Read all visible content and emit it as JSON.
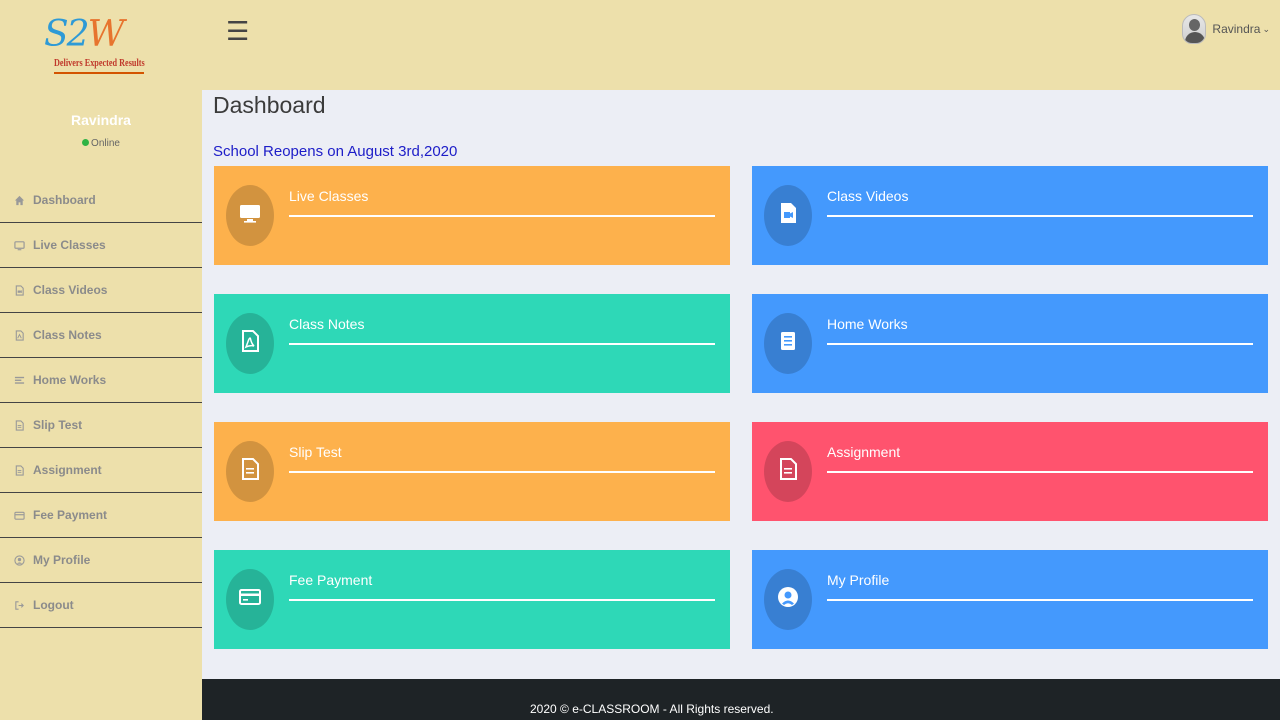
{
  "header": {
    "logo_main_1": "S2",
    "logo_main_2": "W",
    "logo_tagline": "Delivers Expected Results",
    "menu_icon": "hamburger-icon",
    "user_name": "Ravindra",
    "caret_glyph": "⌄"
  },
  "sidebar": {
    "user_name": "Ravindra",
    "status": "Online",
    "items": [
      {
        "label": "Dashboard",
        "icon": "home-icon"
      },
      {
        "label": "Live Classes",
        "icon": "monitor-icon"
      },
      {
        "label": "Class Videos",
        "icon": "video-file-icon"
      },
      {
        "label": "Class Notes",
        "icon": "pdf-file-icon"
      },
      {
        "label": "Home Works",
        "icon": "list-icon"
      },
      {
        "label": "Slip Test",
        "icon": "document-icon"
      },
      {
        "label": "Assignment",
        "icon": "document-icon"
      },
      {
        "label": "Fee Payment",
        "icon": "credit-card-icon"
      },
      {
        "label": "My Profile",
        "icon": "user-circle-icon"
      },
      {
        "label": "Logout",
        "icon": "logout-icon"
      }
    ]
  },
  "main": {
    "title": "Dashboard",
    "notice": "School Reopens on August 3rd,2020",
    "cards": [
      {
        "label": "Live Classes",
        "icon": "monitor-icon",
        "color": "#fdb14c"
      },
      {
        "label": "Class Videos",
        "icon": "video-file-icon",
        "color": "#4499fd"
      },
      {
        "label": "Class Notes",
        "icon": "pdf-file-icon",
        "color": "#2ed8b7"
      },
      {
        "label": "Home Works",
        "icon": "notepad-icon",
        "color": "#4499fd"
      },
      {
        "label": "Slip Test",
        "icon": "document-icon",
        "color": "#fdb14c"
      },
      {
        "label": "Assignment",
        "icon": "document-icon",
        "color": "#ff536e"
      },
      {
        "label": "Fee Payment",
        "icon": "credit-card-icon",
        "color": "#2ed8b7"
      },
      {
        "label": "My Profile",
        "icon": "user-circle-icon",
        "color": "#4499fd"
      }
    ]
  },
  "footer": {
    "text": "2020 © e-CLASSROOM - All Rights reserved."
  }
}
